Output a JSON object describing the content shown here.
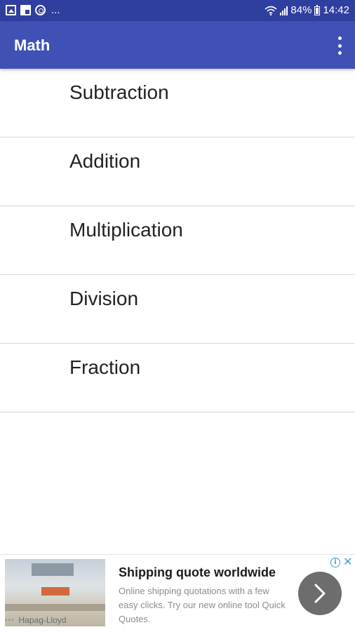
{
  "status_bar": {
    "notification_icons": [
      "image-icon",
      "flipboard-icon",
      "sync-icon"
    ],
    "more_indicator": "...",
    "battery": "84%",
    "time": "14:42"
  },
  "app_bar": {
    "title": "Math",
    "menu_icon": "more-vert-icon"
  },
  "list": {
    "items": [
      {
        "label": "Subtraction"
      },
      {
        "label": "Addition"
      },
      {
        "label": "Multiplication"
      },
      {
        "label": "Division"
      },
      {
        "label": "Fraction"
      }
    ]
  },
  "ad": {
    "title": "Shipping quote worldwide",
    "description": "Online shipping quotations with a few easy clicks. Try our new online tool Quick Quotes.",
    "brand": "Hapag-Lloyd",
    "cta_icon": "chevron-right-icon",
    "info_icon": "info-icon",
    "close_icon": "close-icon"
  },
  "colors": {
    "status_bar": "#2f3fa0",
    "app_bar": "#3f51b5",
    "divider": "#d6d6d6",
    "ad_cta": "#6d6d6d",
    "ad_choices": "#37a0d6"
  }
}
